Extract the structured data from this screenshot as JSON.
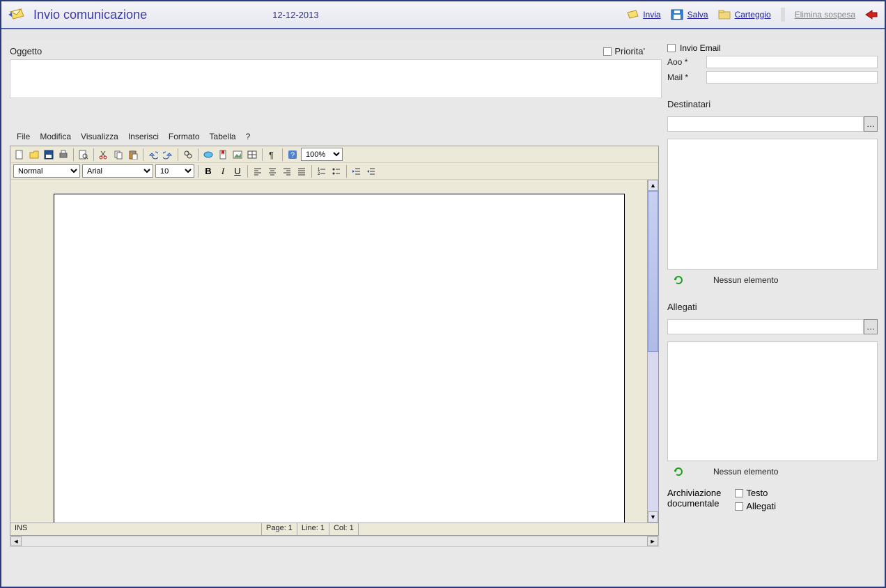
{
  "header": {
    "title": "Invio comunicazione",
    "date": "12-12-2013",
    "actions": {
      "send": "Invia",
      "save": "Salva",
      "carteggio": "Carteggio",
      "elimina": "Elimina sospesa"
    }
  },
  "subject": {
    "label": "Oggetto",
    "priorita_label": "Priorita'",
    "value": ""
  },
  "email": {
    "invio_label": "Invio Email",
    "aoo_label": "Aoo",
    "mail_label": "Mail",
    "required": "*",
    "aoo_value": "",
    "mail_value": ""
  },
  "destinatari": {
    "label": "Destinatari",
    "empty": "Nessun elemento",
    "lookup_value": ""
  },
  "allegati": {
    "label": "Allegati",
    "empty": "Nessun elemento",
    "lookup_value": ""
  },
  "archive": {
    "label1": "Archiviazione",
    "label2": "documentale",
    "testo": "Testo",
    "allegati": "Allegati"
  },
  "menus": {
    "file": "File",
    "modifica": "Modifica",
    "visualizza": "Visualizza",
    "inserisci": "Inserisci",
    "formato": "Formato",
    "tabella": "Tabella",
    "help": "?"
  },
  "toolbar2": {
    "style": "Normal",
    "font": "Arial",
    "size": "10",
    "zoom": "100%"
  },
  "status": {
    "ins": "INS",
    "page": "Page: 1",
    "line": "Line: 1",
    "col": "Col: 1"
  }
}
